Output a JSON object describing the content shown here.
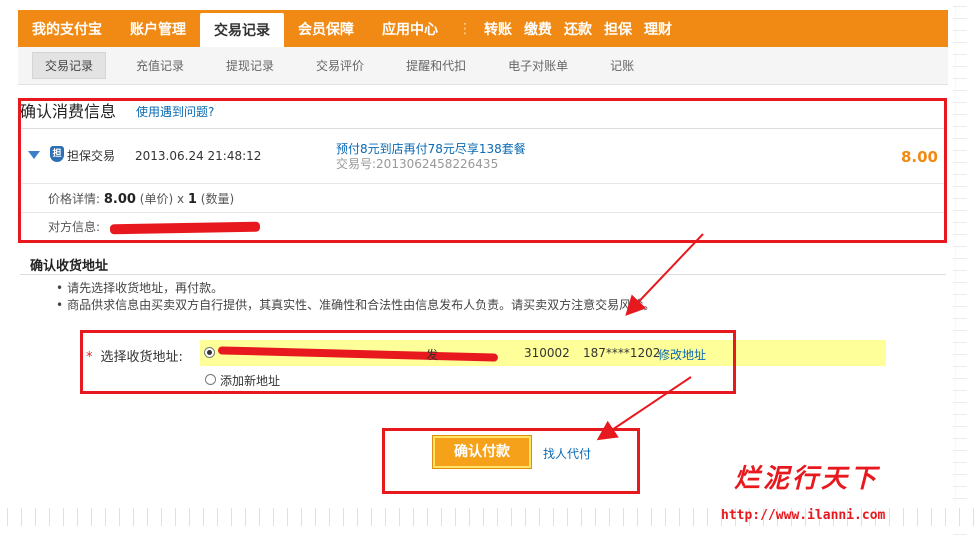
{
  "top_nav": {
    "tabs": [
      "我的支付宝",
      "账户管理",
      "交易记录",
      "会员保障",
      "应用中心"
    ],
    "active": "交易记录",
    "separator": "⋮",
    "quick_links": [
      "转账",
      "缴费",
      "还款",
      "担保",
      "理财"
    ]
  },
  "sub_nav": {
    "items": [
      "交易记录",
      "充值记录",
      "提现记录",
      "交易评价",
      "提醒和代扣",
      "电子对账单",
      "记账"
    ],
    "active": "交易记录"
  },
  "confirm": {
    "title": "确认消费信息",
    "help_link": "使用遇到问题?",
    "trade": {
      "type": "担保交易",
      "time": "2013.06.24 21:48:12",
      "name": "预付8元到店再付78元尽享138套餐",
      "no_label": "交易号:",
      "no": "2013062458226435",
      "amount": "8.00"
    },
    "price_detail": {
      "label": "价格详情:",
      "price": "8.00",
      "price_unit": "(单价)",
      "times": "x",
      "qty": "1",
      "qty_unit": "(数量)"
    },
    "party": {
      "label": "对方信息:"
    }
  },
  "address": {
    "title": "确认收货地址",
    "tips": [
      "请先选择收货地址，再付款。",
      "商品供求信息由买卖双方自行提供，其真实性、准确性和合法性由信息发布人负责。请买卖双方注意交易风险。"
    ],
    "required_mark": "*",
    "select_label": "选择收货地址:",
    "option": {
      "street": "发",
      "zip": "310002",
      "phone": "187****1202",
      "edit": "修改地址"
    },
    "add_new": "添加新地址"
  },
  "pay": {
    "confirm_button": "确认付款",
    "proxy_link": "找人代付"
  },
  "watermark": {
    "cn": "烂泥行天下",
    "url": "http://www.ilanni.com"
  },
  "colors": {
    "nav_orange": "#f08a14",
    "link_blue": "#0a6ab3",
    "annotation_red": "#e8191e",
    "highlight_yellow": "#ffff99"
  }
}
